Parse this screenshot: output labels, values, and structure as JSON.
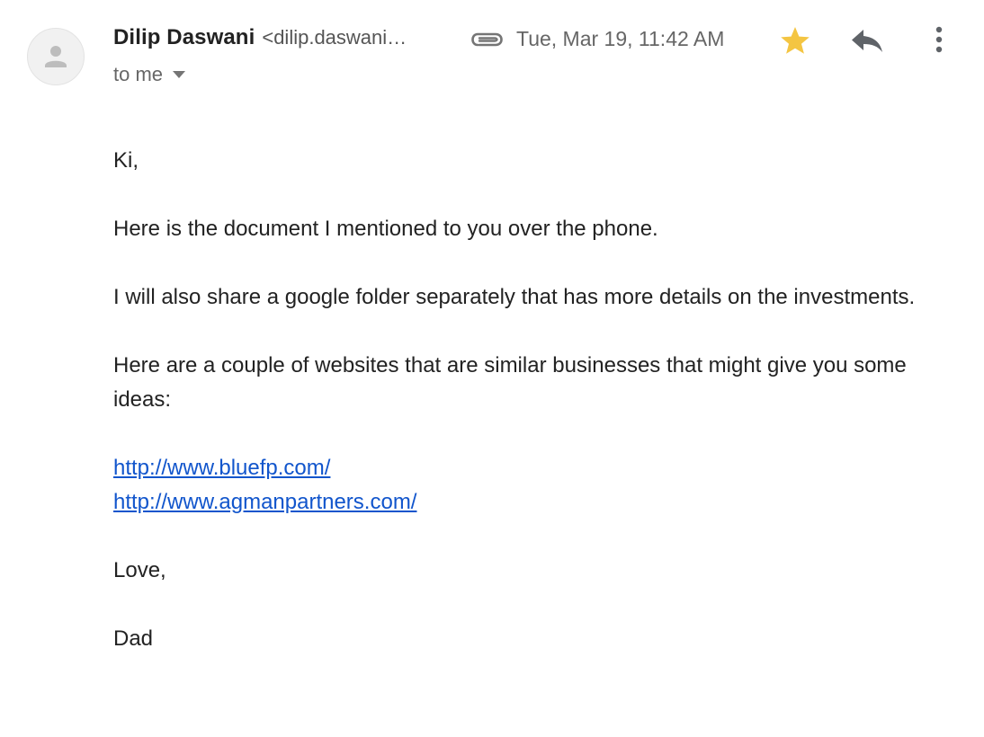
{
  "header": {
    "sender_name": "Dilip Daswani",
    "sender_email": "<dilip.daswani…",
    "date": "Tue, Mar 19, 11:42 AM",
    "to_label": "to me",
    "icons": {
      "avatar": "person-icon",
      "attachment": "paperclip-icon",
      "star": "star-icon",
      "reply": "reply-icon",
      "more": "more-vert-icon",
      "recipients": "chevron-down-icon"
    },
    "colors": {
      "star": "#f4c542",
      "link": "#1155cc",
      "icon": "#616161"
    }
  },
  "message": {
    "greeting": "Ki,",
    "paragraph1": "Here is the document I mentioned to you over the phone.",
    "paragraph2": "I will also share a google folder separately that has more details on the investments.",
    "paragraph3": "Here are a couple of websites that are similar businesses that might give you some ideas:",
    "links": [
      "http://www.bluefp.com/",
      "http://www.agmanpartners.com/"
    ],
    "closing": "Love,",
    "signature": "Dad"
  }
}
